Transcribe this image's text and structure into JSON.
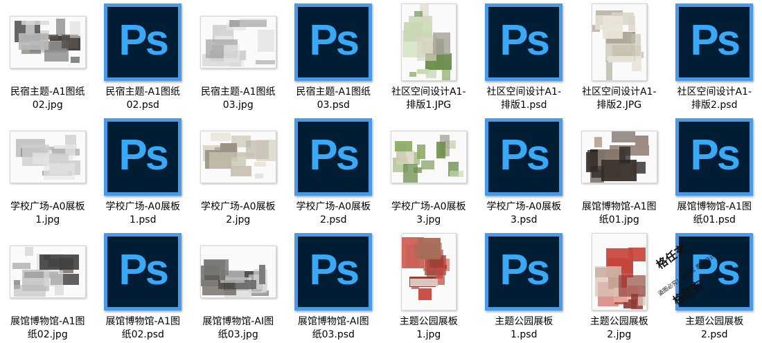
{
  "files": [
    {
      "name": "民宿主题-A1图纸\n02.jpg",
      "kind": "jpg",
      "orientation": "landscape",
      "style": "gray"
    },
    {
      "name": "民宿主题-A1图纸\n02.psd",
      "kind": "psd",
      "icon_text": "Ps"
    },
    {
      "name": "民宿主题-A1图纸\n03.jpg",
      "kind": "jpg",
      "orientation": "landscape",
      "style": "sketch"
    },
    {
      "name": "民宿主题-A1图纸\n03.psd",
      "kind": "psd",
      "icon_text": "Ps"
    },
    {
      "name": "社区空间设计A1-\n排版1.JPG",
      "kind": "jpg",
      "orientation": "portrait",
      "style": "green"
    },
    {
      "name": "社区空间设计A1-\n排版1.psd",
      "kind": "psd",
      "icon_text": "Ps"
    },
    {
      "name": "社区空间设计A1-\n排版2.JPG",
      "kind": "jpg",
      "orientation": "portrait",
      "style": "plan"
    },
    {
      "name": "社区空间设计A1-\n排版2.psd",
      "kind": "psd",
      "icon_text": "Ps"
    },
    {
      "name": "学校广场-A0展板\n1.jpg",
      "kind": "jpg",
      "orientation": "landscape",
      "style": "sketch"
    },
    {
      "name": "学校广场-A0展板\n1.psd",
      "kind": "psd",
      "icon_text": "Ps"
    },
    {
      "name": "学校广场-A0展板\n2.jpg",
      "kind": "jpg",
      "orientation": "landscape",
      "style": "plan"
    },
    {
      "name": "学校广场-A0展板\n2.psd",
      "kind": "psd",
      "icon_text": "Ps"
    },
    {
      "name": "学校广场-A0展板\n3.jpg",
      "kind": "jpg",
      "orientation": "landscape",
      "style": "green"
    },
    {
      "name": "学校广场-A0展板\n3.psd",
      "kind": "psd",
      "icon_text": "Ps"
    },
    {
      "name": "展馆博物馆-A1图\n纸01.jpg",
      "kind": "jpg",
      "orientation": "landscape",
      "style": "dark"
    },
    {
      "name": "展馆博物馆-A1图\n纸01.psd",
      "kind": "psd",
      "icon_text": "Ps"
    },
    {
      "name": "展馆博物馆-A1图\n纸02.jpg",
      "kind": "jpg",
      "orientation": "landscape",
      "style": "gray"
    },
    {
      "name": "展馆博物馆-A1图\n纸02.psd",
      "kind": "psd",
      "icon_text": "Ps"
    },
    {
      "name": "展馆博物馆-AI图\n纸03.jpg",
      "kind": "jpg",
      "orientation": "landscape",
      "style": "gray"
    },
    {
      "name": "展馆博物馆-AI图\n纸03.psd",
      "kind": "psd",
      "icon_text": "Ps"
    },
    {
      "name": "主题公园展板\n1.jpg",
      "kind": "jpg",
      "orientation": "portrait",
      "style": "red"
    },
    {
      "name": "主题公园展板\n1.psd",
      "kind": "psd",
      "icon_text": "Ps"
    },
    {
      "name": "主题公园展板\n2.jpg",
      "kind": "jpg",
      "orientation": "portrait",
      "style": "red"
    },
    {
      "name": "主题公园展板\n2.psd",
      "kind": "psd",
      "icon_text": "Ps"
    }
  ],
  "watermark": {
    "line1": "格任玄",
    "line2": "盗图必究！格任玄 原创设计",
    "line3": "格任玄"
  },
  "colors": {
    "ps_background": "#001d34",
    "ps_border": "#4a9be7",
    "ps_text": "#39a8f6"
  }
}
